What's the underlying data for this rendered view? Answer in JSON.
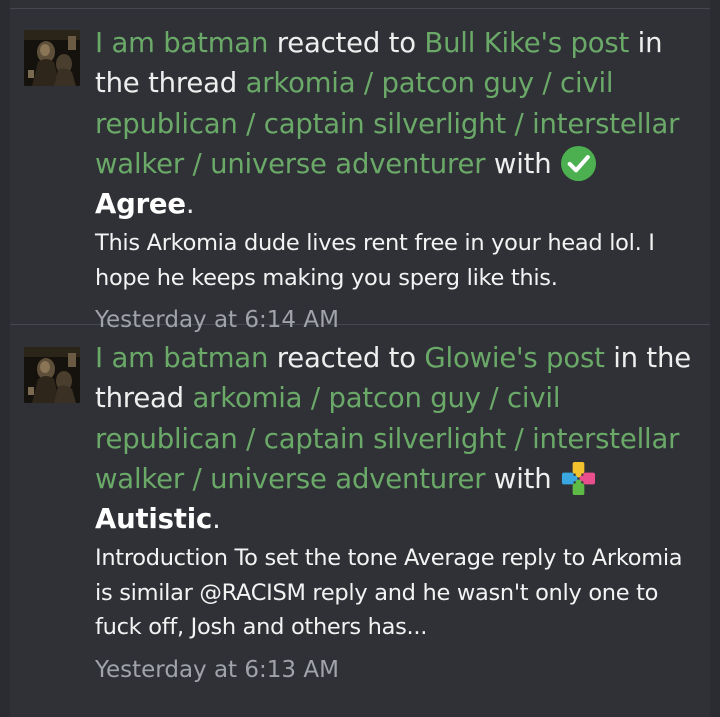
{
  "alerts": [
    {
      "user": "I am batman",
      "reacted_to": "reacted to",
      "post_link": "Bull Kike's post",
      "in_the_thread": "in the thread",
      "thread": "arkomia / patcon guy / civil republican / captain silverlight / interstellar walker / universe adventurer",
      "with": "with",
      "reaction_icon": "agree-check-icon",
      "reaction": "Agree",
      "period": ".",
      "snippet": "This Arkomia dude lives rent free in your head lol. I hope he keeps making you sperg like this.",
      "time": "Yesterday at 6:14 AM"
    },
    {
      "user": "I am batman",
      "reacted_to": "reacted to",
      "post_link": "Glowie's post",
      "in_the_thread": "in the thread",
      "thread": "arkomia / patcon guy / civil republican / captain silverlight / interstellar walker / universe adventurer",
      "with": "with",
      "reaction_icon": "autistic-puzzle-icon",
      "reaction": "Autistic",
      "period": ".",
      "snippet": "Introduction To set the tone Average reply to Arkomia is similar @RACISM reply and he wasn't only one to fuck off, Josh and others has...",
      "time": "Yesterday at 6:13 AM"
    }
  ],
  "colors": {
    "background": "#2f3136",
    "link": "#6aa968",
    "text": "#eeeeee",
    "muted": "#a0a3a9",
    "agree": "#4caf50"
  }
}
